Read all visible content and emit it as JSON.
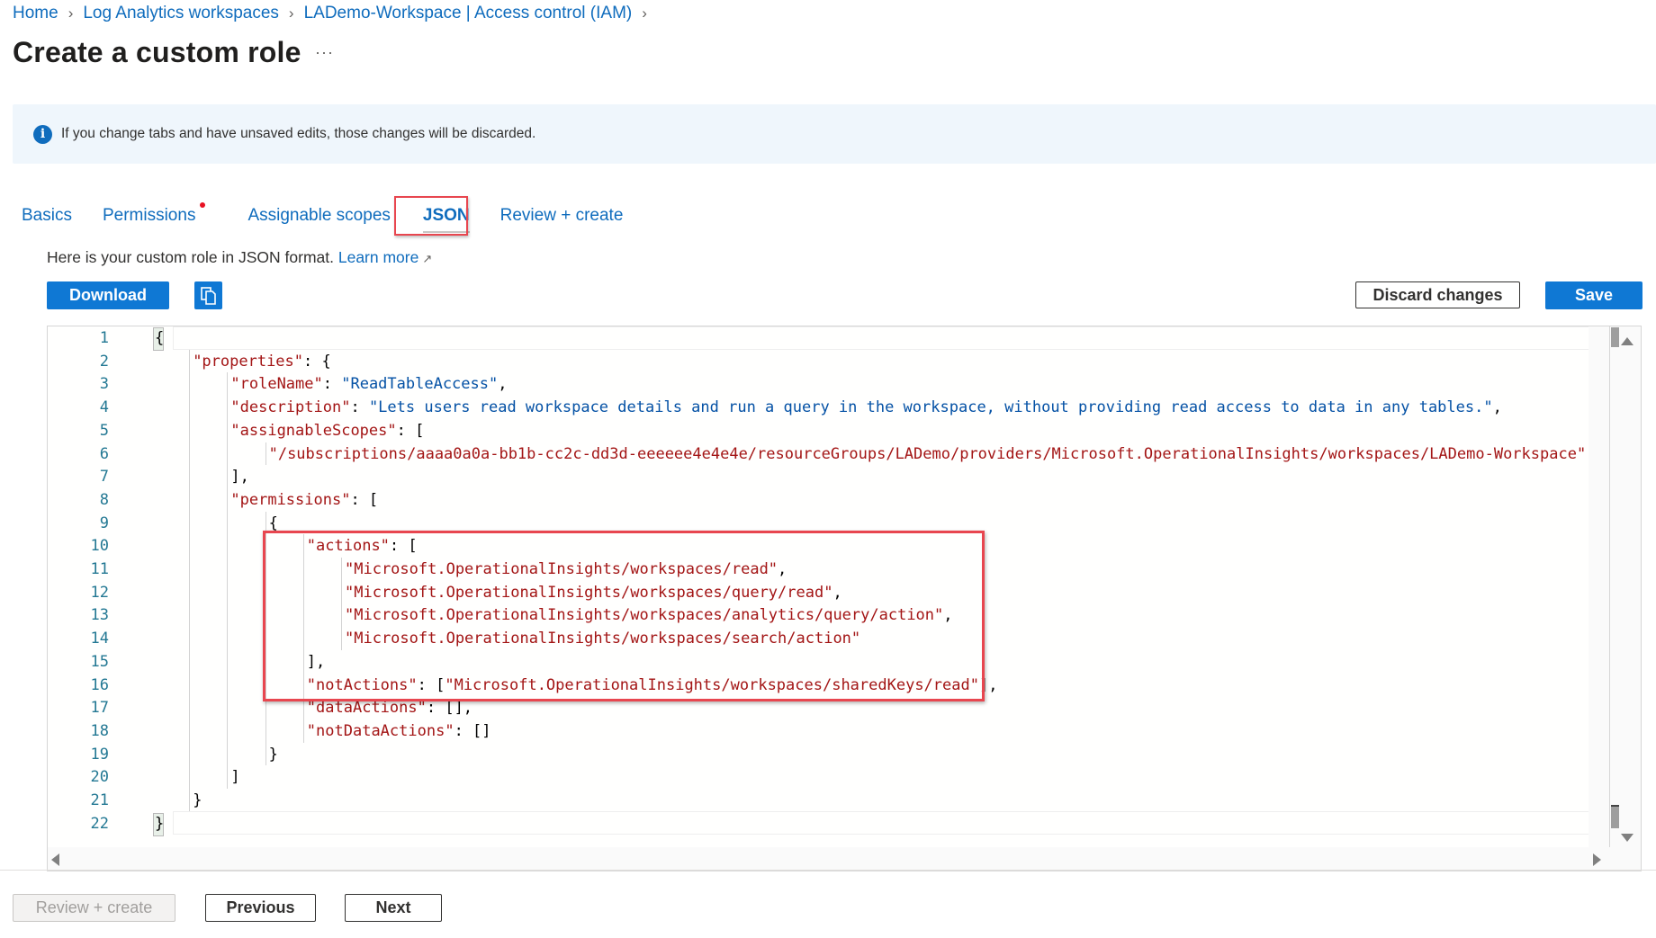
{
  "breadcrumb": {
    "items": [
      "Home",
      "Log Analytics workspaces",
      "LADemo-Workspace | Access control (IAM)"
    ],
    "separator": "›"
  },
  "page": {
    "title": "Create a custom role",
    "more_label": "···"
  },
  "info_bar": {
    "icon": "info-icon",
    "icon_glyph": "i",
    "text": "If you change tabs and have unsaved edits, those changes will be discarded."
  },
  "tabs": {
    "items": [
      {
        "label": "Basics",
        "active": false
      },
      {
        "label": "Permissions",
        "active": false,
        "has_indicator": true
      },
      {
        "label": "Assignable scopes",
        "active": false
      },
      {
        "label": "JSON",
        "active": true
      },
      {
        "label": "Review + create",
        "active": false
      }
    ]
  },
  "description": {
    "text": "Here is your custom role in JSON format.",
    "link_label": "Learn more",
    "link_icon": "external-link-icon",
    "link_icon_glyph": "↗"
  },
  "toolbar": {
    "download_label": "Download",
    "copy_icon": "copy-icon",
    "discard_label": "Discard changes",
    "save_label": "Save"
  },
  "editor": {
    "line_numbers": [
      "1",
      "2",
      "3",
      "4",
      "5",
      "6",
      "7",
      "8",
      "9",
      "10",
      "11",
      "12",
      "13",
      "14",
      "15",
      "16",
      "17",
      "18",
      "19",
      "20",
      "21",
      "22"
    ],
    "lines": [
      {
        "indent": 0,
        "tokens": [
          {
            "t": "{",
            "c": "b1"
          }
        ]
      },
      {
        "indent": 1,
        "tokens": [
          {
            "t": "\"properties\"",
            "c": "k"
          },
          {
            "t": ": {",
            "c": "p"
          }
        ]
      },
      {
        "indent": 2,
        "tokens": [
          {
            "t": "\"roleName\"",
            "c": "k"
          },
          {
            "t": ": ",
            "c": "p"
          },
          {
            "t": "\"ReadTableAccess\"",
            "c": "sv"
          },
          {
            "t": ",",
            "c": "p"
          }
        ]
      },
      {
        "indent": 2,
        "tokens": [
          {
            "t": "\"description\"",
            "c": "k"
          },
          {
            "t": ": ",
            "c": "p"
          },
          {
            "t": "\"Lets users read workspace details and run a query in the workspace, without providing read access to data in any tables.\"",
            "c": "sv"
          },
          {
            "t": ",",
            "c": "p"
          }
        ]
      },
      {
        "indent": 2,
        "tokens": [
          {
            "t": "\"assignableScopes\"",
            "c": "k"
          },
          {
            "t": ": [",
            "c": "p"
          }
        ]
      },
      {
        "indent": 3,
        "tokens": [
          {
            "t": "\"/subscriptions/aaaa0a0a-bb1b-cc2c-dd3d-eeeeee4e4e4e/resourceGroups/LADemo/providers/Microsoft.OperationalInsights/workspaces/LADemo-Workspace\"",
            "c": "s"
          }
        ]
      },
      {
        "indent": 2,
        "tokens": [
          {
            "t": "],",
            "c": "p"
          }
        ]
      },
      {
        "indent": 2,
        "tokens": [
          {
            "t": "\"permissions\"",
            "c": "k"
          },
          {
            "t": ": [",
            "c": "p"
          }
        ]
      },
      {
        "indent": 3,
        "tokens": [
          {
            "t": "{",
            "c": "p"
          }
        ]
      },
      {
        "indent": 4,
        "tokens": [
          {
            "t": "\"actions\"",
            "c": "k"
          },
          {
            "t": ": [",
            "c": "p"
          }
        ]
      },
      {
        "indent": 5,
        "tokens": [
          {
            "t": "\"Microsoft.OperationalInsights/workspaces/read\"",
            "c": "s"
          },
          {
            "t": ",",
            "c": "p"
          }
        ]
      },
      {
        "indent": 5,
        "tokens": [
          {
            "t": "\"Microsoft.OperationalInsights/workspaces/query/read\"",
            "c": "s"
          },
          {
            "t": ",",
            "c": "p"
          }
        ]
      },
      {
        "indent": 5,
        "tokens": [
          {
            "t": "\"Microsoft.OperationalInsights/workspaces/analytics/query/action\"",
            "c": "s"
          },
          {
            "t": ",",
            "c": "p"
          }
        ]
      },
      {
        "indent": 5,
        "tokens": [
          {
            "t": "\"Microsoft.OperationalInsights/workspaces/search/action\"",
            "c": "s"
          }
        ]
      },
      {
        "indent": 4,
        "tokens": [
          {
            "t": "],",
            "c": "p"
          }
        ]
      },
      {
        "indent": 4,
        "tokens": [
          {
            "t": "\"notActions\"",
            "c": "k"
          },
          {
            "t": ": [",
            "c": "p"
          },
          {
            "t": "\"Microsoft.OperationalInsights/workspaces/sharedKeys/read\"",
            "c": "s"
          },
          {
            "t": "],",
            "c": "p"
          }
        ]
      },
      {
        "indent": 4,
        "tokens": [
          {
            "t": "\"dataActions\"",
            "c": "k"
          },
          {
            "t": ": [],",
            "c": "p"
          }
        ]
      },
      {
        "indent": 4,
        "tokens": [
          {
            "t": "\"notDataActions\"",
            "c": "k"
          },
          {
            "t": ": []",
            "c": "p"
          }
        ]
      },
      {
        "indent": 3,
        "tokens": [
          {
            "t": "}",
            "c": "p"
          }
        ]
      },
      {
        "indent": 2,
        "tokens": [
          {
            "t": "]",
            "c": "p"
          }
        ]
      },
      {
        "indent": 1,
        "tokens": [
          {
            "t": "}",
            "c": "p"
          }
        ]
      },
      {
        "indent": 0,
        "tokens": [
          {
            "t": "}",
            "c": "b1"
          }
        ]
      }
    ]
  },
  "footer": {
    "review_create_label": "Review + create",
    "previous_label": "Previous",
    "next_label": "Next"
  },
  "colors": {
    "accent": "#0f78d4",
    "link": "#0f6cbd",
    "highlight_border": "#e8464f",
    "info_bg": "#eff6fc",
    "json_key": "#a31515",
    "json_string_value": "#0451a5",
    "line_number": "#237893"
  }
}
